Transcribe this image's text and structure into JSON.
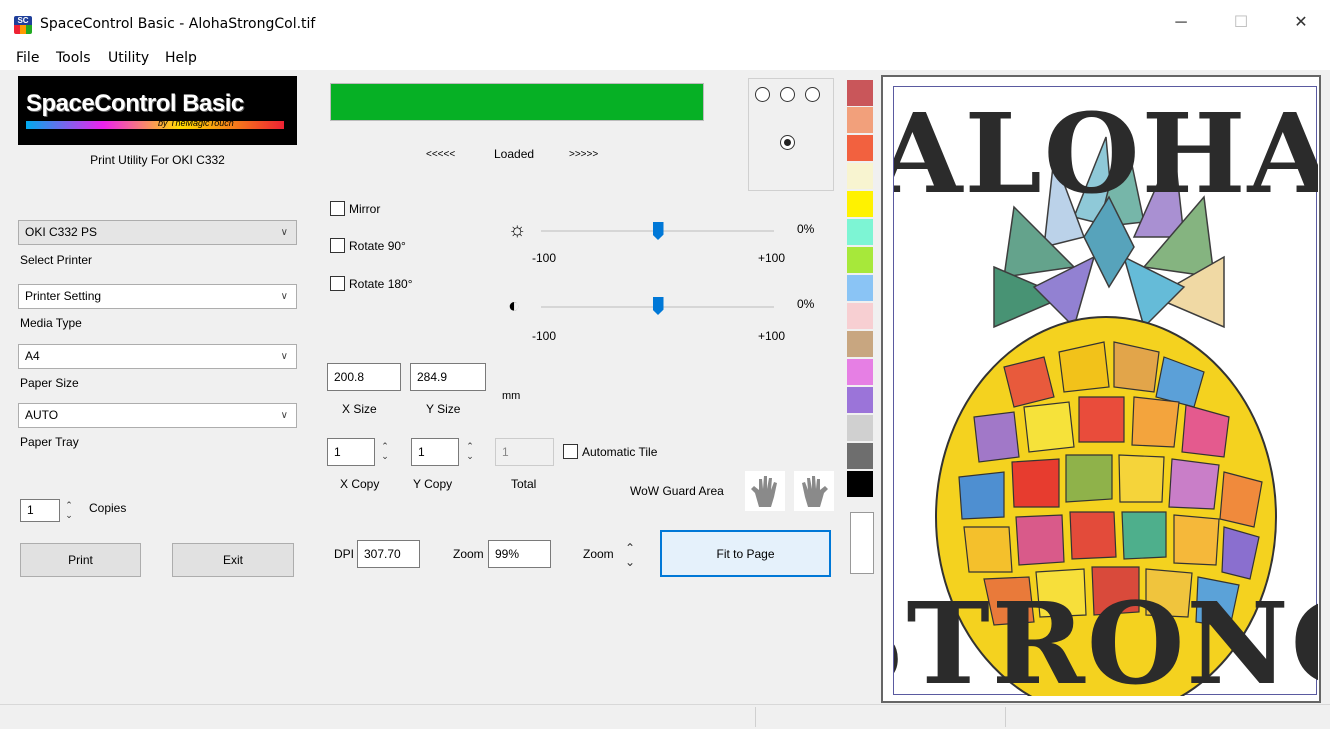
{
  "window": {
    "title": "SpaceControl Basic - AlohaStrongCol.tif",
    "app_icon_text": "SC",
    "minimize": "─",
    "maximize": "☐",
    "close": "✕"
  },
  "menu": [
    "File",
    "Tools",
    "Utility",
    "Help"
  ],
  "logo": {
    "title": "SpaceControl Basic",
    "byline": "by TheMagicTouch"
  },
  "subtitle": "Print Utility For OKI C332",
  "printer": {
    "value": "OKI C332 PS",
    "label": "Select Printer"
  },
  "media": {
    "value": "Printer Setting",
    "label": "Media Type"
  },
  "paper": {
    "value": "A4",
    "label": "Paper Size"
  },
  "tray": {
    "value": "AUTO",
    "label": "Paper Tray"
  },
  "copies": {
    "value": "1",
    "label": "Copies"
  },
  "buttons": {
    "print": "Print",
    "exit": "Exit",
    "fit": "Fit to Page"
  },
  "status": {
    "left": "<<<<<",
    "text": "Loaded",
    "right": ">>>>>",
    "progress": 1.0
  },
  "options": {
    "mirror": "Mirror",
    "rotate90": "Rotate 90°",
    "rotate180": "Rotate 180°"
  },
  "brightness": {
    "value": "0%",
    "min": "-100",
    "max": "+100",
    "level": 0
  },
  "contrast": {
    "value": "0%",
    "min": "-100",
    "max": "+100",
    "level": 0
  },
  "size": {
    "x": "200.8",
    "y": "284.9",
    "x_label": "X Size",
    "y_label": "Y Size",
    "unit": "mm"
  },
  "copy": {
    "x": "1",
    "y": "1",
    "total": "1",
    "x_label": "X Copy",
    "y_label": "Y Copy",
    "total_label": "Total",
    "auto_tile": "Automatic Tile"
  },
  "wow": {
    "label": "WoW Guard Area"
  },
  "dpi": {
    "label": "DPI",
    "value": "307.70"
  },
  "zoom": {
    "label": "Zoom",
    "value": "99%",
    "spin_label": "Zoom"
  },
  "palette": [
    "#c9565a",
    "#f2a07b",
    "#f2613f",
    "#f8f4d0",
    "#fff200",
    "#7df5d4",
    "#a7e83a",
    "#8ac4f5",
    "#f7cfd2",
    "#c8a680",
    "#e67fe4",
    "#9b74d9",
    "#d0d0d0",
    "#6e6e6e",
    "#000000",
    "#ffffff"
  ],
  "preview": {
    "top_word": "ALOHA",
    "bottom_word": "STRONG"
  }
}
